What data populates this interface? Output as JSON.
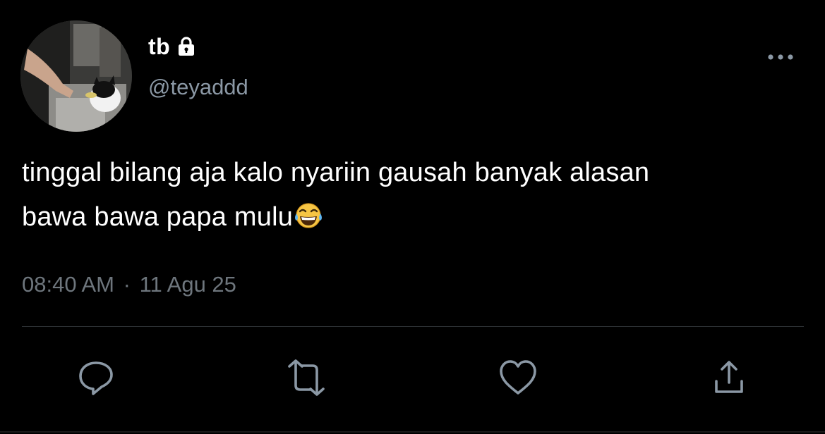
{
  "author": {
    "display_name": "tb",
    "handle": "@teyaddd",
    "protected": true,
    "avatar_icon": "avatar-photo-cat"
  },
  "tweet": {
    "text_line1": "tinggal bilang aja kalo nyariin gausah banyak alasan",
    "text_line2": "bawa bawa papa mulu",
    "emoji": "😂",
    "time": "08:40 AM",
    "separator": "·",
    "date": "11 Agu 25"
  },
  "icons": {
    "lock": "lock-icon",
    "more": "more-horizontal-icon",
    "reply": "reply-icon",
    "retweet": "retweet-icon",
    "like": "heart-icon",
    "share": "share-icon"
  },
  "colors": {
    "background": "#000000",
    "text_primary": "#ffffff",
    "text_secondary": "#8b98a5",
    "icon": "#8b98a5",
    "divider": "#2f3336"
  }
}
